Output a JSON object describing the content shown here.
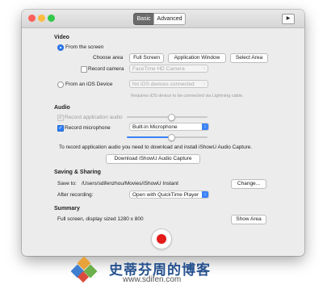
{
  "tabs": {
    "basic": "Basic",
    "advanced": "Advanced"
  },
  "video": {
    "heading": "Video",
    "from_screen": "From the screen",
    "choose_area_label": "Choose area",
    "area_buttons": [
      "Full Screen",
      "Application Window",
      "Select Area"
    ],
    "record_camera_label": "Record camera",
    "camera_value": "FaceTime HD Camera",
    "from_ios": "From an iOS Device",
    "ios_value": "No iOS devices connected",
    "ios_hint": "Requires iOS device to be connected via Lightning cable."
  },
  "audio": {
    "heading": "Audio",
    "record_app_audio": "Record application audio",
    "record_microphone": "Record microphone",
    "microphone_value": "Built-in Microphone",
    "notice": "To record application audio you need to download and install iShowU Audio Capture.",
    "download_button": "Download iShowU Audio Capture",
    "app_audio_level": 0.55,
    "mic_level": 0.55
  },
  "saving": {
    "heading": "Saving & Sharing",
    "save_to_label": "Save to:",
    "save_path": "/Users/sdifenzhou/Movies/iShowU Instant",
    "change_button": "Change...",
    "after_label": "After recording:",
    "after_value": "Open with QuickTime Player"
  },
  "summary": {
    "heading": "Summary",
    "text": "Full screen, display sized 1280 x 800",
    "show_area_button": "Show Area"
  },
  "watermark": {
    "title": "史蒂芬周的博客",
    "url": "www.sdifen.com"
  },
  "colors": {
    "accent": "#3b82f6",
    "record": "#e21b1b",
    "brand": "#27528f"
  }
}
